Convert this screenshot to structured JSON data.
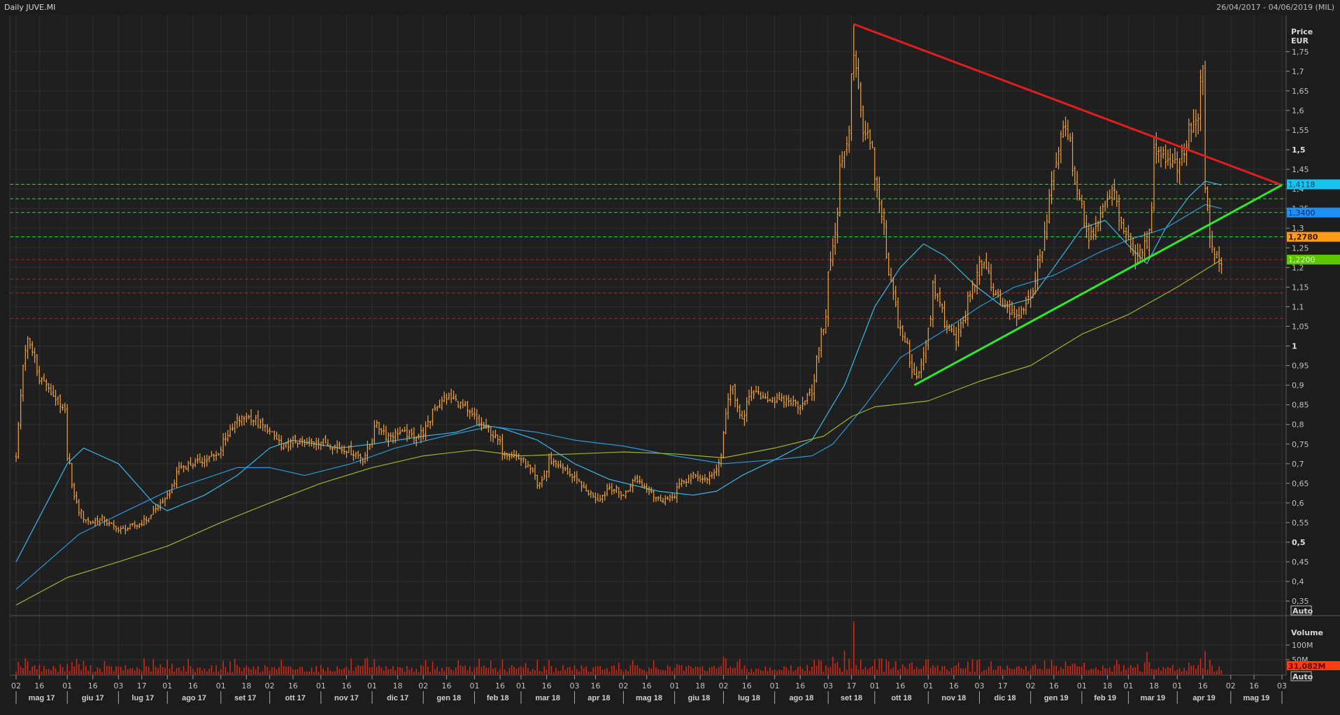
{
  "header": {
    "title": "Daily JUVE.MI",
    "range": "26/04/2017 - 04/06/2019 (MIL)"
  },
  "price_axis": {
    "title": "Price",
    "currency": "EUR",
    "auto": "Auto"
  },
  "volume_axis": {
    "title": "Volume",
    "auto": "Auto",
    "ticks": [
      "100M",
      "50M"
    ],
    "tick_values": [
      100,
      50
    ],
    "last_label": "31,082M",
    "last_color": "#ff3c14"
  },
  "chart_data": {
    "type": "ohlc",
    "title": "Daily JUVE.MI",
    "ylabel": "Price EUR",
    "ylim": [
      0.32,
      1.85
    ],
    "y_ticks": [
      "1,75",
      "1,7",
      "1,65",
      "1,6",
      "1,55",
      "1,5",
      "1,45",
      "1,4",
      "1,35",
      "1,3",
      "1,25",
      "1,2",
      "1,15",
      "1,1",
      "1,05",
      "1",
      "0,95",
      "0,9",
      "0,85",
      "0,8",
      "0,75",
      "0,7",
      "0,65",
      "0,6",
      "0,55",
      "0,5",
      "0,45",
      "0,4",
      "0,35"
    ],
    "y_tick_values": [
      1.75,
      1.7,
      1.65,
      1.6,
      1.55,
      1.5,
      1.45,
      1.4,
      1.35,
      1.3,
      1.25,
      1.2,
      1.15,
      1.1,
      1.05,
      1,
      0.95,
      0.9,
      0.85,
      0.8,
      0.75,
      0.7,
      0.65,
      0.6,
      0.55,
      0.5,
      0.45,
      0.4,
      0.35
    ],
    "y_bold": [
      1.5,
      1,
      0.5
    ],
    "x_range": [
      "2017-05-02",
      "2019-06-03"
    ],
    "close_path": [
      [
        "2017-05-02",
        0.72
      ],
      [
        "2017-05-05",
        0.95
      ],
      [
        "2017-05-09",
        1.01
      ],
      [
        "2017-05-16",
        0.92
      ],
      [
        "2017-05-23",
        0.88
      ],
      [
        "2017-05-31",
        0.83
      ],
      [
        "2017-06-01",
        0.72
      ],
      [
        "2017-06-08",
        0.58
      ],
      [
        "2017-06-15",
        0.55
      ],
      [
        "2017-06-22",
        0.56
      ],
      [
        "2017-07-03",
        0.53
      ],
      [
        "2017-07-10",
        0.54
      ],
      [
        "2017-07-17",
        0.55
      ],
      [
        "2017-07-24",
        0.58
      ],
      [
        "2017-08-01",
        0.62
      ],
      [
        "2017-08-08",
        0.69
      ],
      [
        "2017-08-16",
        0.7
      ],
      [
        "2017-08-23",
        0.71
      ],
      [
        "2017-08-30",
        0.72
      ],
      [
        "2017-09-05",
        0.77
      ],
      [
        "2017-09-12",
        0.81
      ],
      [
        "2017-09-18",
        0.82
      ],
      [
        "2017-09-26",
        0.8
      ],
      [
        "2017-10-02",
        0.78
      ],
      [
        "2017-10-09",
        0.74
      ],
      [
        "2017-10-16",
        0.76
      ],
      [
        "2017-10-23",
        0.75
      ],
      [
        "2017-10-30",
        0.76
      ],
      [
        "2017-11-06",
        0.75
      ],
      [
        "2017-11-13",
        0.74
      ],
      [
        "2017-11-20",
        0.73
      ],
      [
        "2017-11-27",
        0.71
      ],
      [
        "2017-12-04",
        0.8
      ],
      [
        "2017-12-11",
        0.77
      ],
      [
        "2017-12-18",
        0.78
      ],
      [
        "2017-12-27",
        0.77
      ],
      [
        "2018-01-02",
        0.78
      ],
      [
        "2018-01-08",
        0.84
      ],
      [
        "2018-01-15",
        0.87
      ],
      [
        "2018-01-22",
        0.86
      ],
      [
        "2018-01-29",
        0.83
      ],
      [
        "2018-02-05",
        0.8
      ],
      [
        "2018-02-12",
        0.78
      ],
      [
        "2018-02-19",
        0.73
      ],
      [
        "2018-02-26",
        0.72
      ],
      [
        "2018-03-05",
        0.7
      ],
      [
        "2018-03-12",
        0.64
      ],
      [
        "2018-03-19",
        0.71
      ],
      [
        "2018-03-26",
        0.69
      ],
      [
        "2018-04-03",
        0.66
      ],
      [
        "2018-04-10",
        0.63
      ],
      [
        "2018-04-17",
        0.61
      ],
      [
        "2018-04-24",
        0.64
      ],
      [
        "2018-05-02",
        0.62
      ],
      [
        "2018-05-09",
        0.66
      ],
      [
        "2018-05-16",
        0.64
      ],
      [
        "2018-05-23",
        0.61
      ],
      [
        "2018-05-30",
        0.61
      ],
      [
        "2018-06-06",
        0.65
      ],
      [
        "2018-06-13",
        0.67
      ],
      [
        "2018-06-20",
        0.66
      ],
      [
        "2018-06-27",
        0.68
      ],
      [
        "2018-07-02",
        0.78
      ],
      [
        "2018-07-05",
        0.9
      ],
      [
        "2018-07-12",
        0.82
      ],
      [
        "2018-07-19",
        0.88
      ],
      [
        "2018-07-26",
        0.87
      ],
      [
        "2018-08-02",
        0.86
      ],
      [
        "2018-08-09",
        0.86
      ],
      [
        "2018-08-16",
        0.85
      ],
      [
        "2018-08-23",
        0.88
      ],
      [
        "2018-08-30",
        1.05
      ],
      [
        "2018-09-05",
        1.25
      ],
      [
        "2018-09-10",
        1.45
      ],
      [
        "2018-09-14",
        1.55
      ],
      [
        "2018-09-18",
        1.75
      ],
      [
        "2018-09-21",
        1.6
      ],
      [
        "2018-09-28",
        1.5
      ],
      [
        "2018-10-05",
        1.3
      ],
      [
        "2018-10-12",
        1.1
      ],
      [
        "2018-10-19",
        1.0
      ],
      [
        "2018-10-24",
        0.92
      ],
      [
        "2018-10-29",
        0.96
      ],
      [
        "2018-11-05",
        1.15
      ],
      [
        "2018-11-12",
        1.05
      ],
      [
        "2018-11-19",
        1.02
      ],
      [
        "2018-11-26",
        1.12
      ],
      [
        "2018-12-03",
        1.22
      ],
      [
        "2018-12-10",
        1.15
      ],
      [
        "2018-12-17",
        1.1
      ],
      [
        "2018-12-24",
        1.07
      ],
      [
        "2019-01-02",
        1.12
      ],
      [
        "2019-01-09",
        1.25
      ],
      [
        "2019-01-16",
        1.45
      ],
      [
        "2019-01-23",
        1.57
      ],
      [
        "2019-01-30",
        1.4
      ],
      [
        "2019-02-06",
        1.28
      ],
      [
        "2019-02-13",
        1.33
      ],
      [
        "2019-02-20",
        1.4
      ],
      [
        "2019-02-27",
        1.3
      ],
      [
        "2019-03-06",
        1.22
      ],
      [
        "2019-03-13",
        1.26
      ],
      [
        "2019-03-18",
        1.5
      ],
      [
        "2019-03-25",
        1.48
      ],
      [
        "2019-04-01",
        1.46
      ],
      [
        "2019-04-08",
        1.55
      ],
      [
        "2019-04-12",
        1.58
      ],
      [
        "2019-04-16",
        1.7
      ],
      [
        "2019-04-17",
        1.4
      ],
      [
        "2019-04-19",
        1.28
      ],
      [
        "2019-04-26",
        1.2
      ]
    ],
    "peak": {
      "date": "2018-09-18",
      "high": 1.82
    },
    "moving_averages": [
      {
        "name": "MA fast",
        "color": "#39b8e8",
        "points": [
          [
            "2017-05-02",
            0.45
          ],
          [
            "2017-06-01",
            0.7
          ],
          [
            "2017-06-12",
            0.74
          ],
          [
            "2017-07-03",
            0.7
          ],
          [
            "2017-07-24",
            0.6
          ],
          [
            "2017-08-01",
            0.58
          ],
          [
            "2017-08-23",
            0.62
          ],
          [
            "2017-09-12",
            0.67
          ],
          [
            "2017-10-02",
            0.74
          ],
          [
            "2017-10-16",
            0.76
          ],
          [
            "2017-11-13",
            0.74
          ],
          [
            "2017-12-01",
            0.75
          ],
          [
            "2018-01-02",
            0.77
          ],
          [
            "2018-01-22",
            0.78
          ],
          [
            "2018-02-05",
            0.8
          ],
          [
            "2018-02-19",
            0.79
          ],
          [
            "2018-03-12",
            0.76
          ],
          [
            "2018-04-03",
            0.7
          ],
          [
            "2018-04-24",
            0.66
          ],
          [
            "2018-05-23",
            0.63
          ],
          [
            "2018-06-13",
            0.62
          ],
          [
            "2018-06-27",
            0.63
          ],
          [
            "2018-07-12",
            0.67
          ],
          [
            "2018-08-01",
            0.71
          ],
          [
            "2018-08-23",
            0.76
          ],
          [
            "2018-09-12",
            0.9
          ],
          [
            "2018-10-01",
            1.1
          ],
          [
            "2018-10-16",
            1.2
          ],
          [
            "2018-10-30",
            1.26
          ],
          [
            "2018-11-12",
            1.23
          ],
          [
            "2018-11-30",
            1.15
          ],
          [
            "2018-12-17",
            1.1
          ],
          [
            "2019-01-02",
            1.12
          ],
          [
            "2019-01-16",
            1.2
          ],
          [
            "2019-02-01",
            1.3
          ],
          [
            "2019-02-15",
            1.32
          ],
          [
            "2019-03-04",
            1.25
          ],
          [
            "2019-03-13",
            1.21
          ],
          [
            "2019-03-25",
            1.3
          ],
          [
            "2019-04-08",
            1.38
          ],
          [
            "2019-04-17",
            1.42
          ],
          [
            "2019-04-26",
            1.41
          ]
        ]
      },
      {
        "name": "MA medium",
        "color": "#2a9ad8",
        "points": [
          [
            "2017-05-02",
            0.38
          ],
          [
            "2017-06-08",
            0.52
          ],
          [
            "2017-07-03",
            0.57
          ],
          [
            "2017-08-01",
            0.63
          ],
          [
            "2017-09-12",
            0.69
          ],
          [
            "2017-10-02",
            0.69
          ],
          [
            "2017-10-23",
            0.67
          ],
          [
            "2017-11-20",
            0.7
          ],
          [
            "2017-12-15",
            0.74
          ],
          [
            "2018-01-15",
            0.77
          ],
          [
            "2018-02-12",
            0.795
          ],
          [
            "2018-03-12",
            0.78
          ],
          [
            "2018-04-03",
            0.76
          ],
          [
            "2018-05-02",
            0.745
          ],
          [
            "2018-06-01",
            0.72
          ],
          [
            "2018-07-02",
            0.7
          ],
          [
            "2018-08-01",
            0.71
          ],
          [
            "2018-08-23",
            0.72
          ],
          [
            "2018-09-05",
            0.75
          ],
          [
            "2018-09-25",
            0.85
          ],
          [
            "2018-10-16",
            0.97
          ],
          [
            "2018-11-12",
            1.04
          ],
          [
            "2018-12-03",
            1.1
          ],
          [
            "2018-12-24",
            1.15
          ],
          [
            "2019-01-16",
            1.18
          ],
          [
            "2019-02-13",
            1.24
          ],
          [
            "2019-03-01",
            1.27
          ],
          [
            "2019-03-25",
            1.3
          ],
          [
            "2019-04-17",
            1.36
          ],
          [
            "2019-04-26",
            1.35
          ]
        ]
      },
      {
        "name": "MA slow",
        "color": "#9ab828",
        "points": [
          [
            "2017-05-02",
            0.34
          ],
          [
            "2017-06-01",
            0.41
          ],
          [
            "2017-07-03",
            0.45
          ],
          [
            "2017-08-01",
            0.49
          ],
          [
            "2017-09-01",
            0.55
          ],
          [
            "2017-10-02",
            0.6
          ],
          [
            "2017-11-01",
            0.65
          ],
          [
            "2017-12-01",
            0.69
          ],
          [
            "2018-01-02",
            0.72
          ],
          [
            "2018-02-01",
            0.735
          ],
          [
            "2018-03-01",
            0.72
          ],
          [
            "2018-04-03",
            0.725
          ],
          [
            "2018-05-02",
            0.73
          ],
          [
            "2018-06-01",
            0.725
          ],
          [
            "2018-07-02",
            0.715
          ],
          [
            "2018-08-01",
            0.74
          ],
          [
            "2018-08-30",
            0.77
          ],
          [
            "2018-09-17",
            0.82
          ],
          [
            "2018-10-01",
            0.845
          ],
          [
            "2018-11-01",
            0.86
          ],
          [
            "2018-12-03",
            0.91
          ],
          [
            "2019-01-02",
            0.95
          ],
          [
            "2019-02-01",
            1.03
          ],
          [
            "2019-03-01",
            1.08
          ],
          [
            "2019-04-01",
            1.15
          ],
          [
            "2019-04-26",
            1.22
          ]
        ]
      }
    ],
    "trendlines": [
      {
        "name": "resistance",
        "color": "#e01e1e",
        "from": [
          "2018-09-18",
          1.82
        ],
        "to": [
          "2019-06-03",
          1.41
        ]
      },
      {
        "name": "support",
        "color": "#2ee82e",
        "from": [
          "2018-10-24",
          0.9
        ],
        "to": [
          "2019-06-03",
          1.41
        ]
      }
    ],
    "horizontal_levels": {
      "green": [
        1.4118,
        1.375,
        1.34,
        1.278
      ],
      "red": [
        1.22,
        1.17,
        1.135,
        1.07
      ]
    },
    "price_labels": [
      {
        "text": "1,4118",
        "value": 1.4118,
        "bg": "#19c3ef",
        "fg": "#0a3d6a"
      },
      {
        "text": "1,3400",
        "value": 1.34,
        "bg": "#1e8fff",
        "fg": "#0a2a5a"
      },
      {
        "text": "1,2780",
        "value": 1.278,
        "bg": "#ff9a1a",
        "fg": "#3a1a00"
      },
      {
        "text": "1,2200",
        "value": 1.22,
        "bg": "#5cc800",
        "fg": "#dff5c0"
      }
    ],
    "volume": {
      "unit": "M",
      "typical": 20,
      "spikes": [
        [
          "2017-05-09",
          45
        ],
        [
          "2017-06-01",
          35
        ],
        [
          "2018-07-02",
          60
        ],
        [
          "2018-09-05",
          60
        ],
        [
          "2018-09-18",
          180
        ],
        [
          "2018-09-12",
          80
        ],
        [
          "2018-10-12",
          45
        ],
        [
          "2019-01-23",
          45
        ],
        [
          "2019-03-13",
          75
        ],
        [
          "2019-04-17",
          80
        ],
        [
          "2019-04-19",
          50
        ]
      ]
    },
    "x_ticks": [
      [
        "2017-05-02",
        "02"
      ],
      [
        "2017-05-16",
        "16"
      ],
      [
        "2017-06-01",
        "01"
      ],
      [
        "2017-06-16",
        "16"
      ],
      [
        "2017-07-03",
        "03"
      ],
      [
        "2017-07-17",
        "17"
      ],
      [
        "2017-08-01",
        "01"
      ],
      [
        "2017-08-16",
        "16"
      ],
      [
        "2017-09-01",
        "01"
      ],
      [
        "2017-09-18",
        "18"
      ],
      [
        "2017-10-02",
        "02"
      ],
      [
        "2017-10-16",
        "16"
      ],
      [
        "2017-11-01",
        "01"
      ],
      [
        "2017-11-16",
        "16"
      ],
      [
        "2017-12-01",
        "01"
      ],
      [
        "2017-12-18",
        "18"
      ],
      [
        "2018-01-02",
        "02"
      ],
      [
        "2018-01-16",
        "16"
      ],
      [
        "2018-02-01",
        "01"
      ],
      [
        "2018-02-16",
        "16"
      ],
      [
        "2018-03-01",
        "01"
      ],
      [
        "2018-03-16",
        "16"
      ],
      [
        "2018-04-03",
        "03"
      ],
      [
        "2018-04-16",
        "16"
      ],
      [
        "2018-05-02",
        "02"
      ],
      [
        "2018-05-16",
        "16"
      ],
      [
        "2018-06-01",
        "01"
      ],
      [
        "2018-06-18",
        "18"
      ],
      [
        "2018-07-02",
        "02"
      ],
      [
        "2018-07-16",
        "16"
      ],
      [
        "2018-08-01",
        "01"
      ],
      [
        "2018-08-16",
        "16"
      ],
      [
        "2018-09-03",
        "03"
      ],
      [
        "2018-09-17",
        "17"
      ],
      [
        "2018-10-01",
        "01"
      ],
      [
        "2018-10-16",
        "16"
      ],
      [
        "2018-11-01",
        "01"
      ],
      [
        "2018-11-16",
        "16"
      ],
      [
        "2018-12-03",
        "03"
      ],
      [
        "2018-12-17",
        "17"
      ],
      [
        "2019-01-02",
        "02"
      ],
      [
        "2019-01-16",
        "16"
      ],
      [
        "2019-02-01",
        "01"
      ],
      [
        "2019-02-18",
        "18"
      ],
      [
        "2019-03-01",
        "01"
      ],
      [
        "2019-03-18",
        "18"
      ],
      [
        "2019-04-01",
        "01"
      ],
      [
        "2019-04-16",
        "16"
      ],
      [
        "2019-05-02",
        "02"
      ],
      [
        "2019-05-16",
        "16"
      ],
      [
        "2019-06-03",
        "03"
      ]
    ],
    "months": [
      "mag 17",
      "giu 17",
      "lug 17",
      "ago 17",
      "set 17",
      "ott 17",
      "nov 17",
      "dic 17",
      "gen 18",
      "feb 18",
      "mar 18",
      "apr 18",
      "mag 18",
      "giu 18",
      "lug 18",
      "ago 18",
      "set 18",
      "ott 18",
      "nov 18",
      "dic 18",
      "gen 19",
      "feb 19",
      "mar 19",
      "apr 19",
      "mag 19"
    ],
    "colors": {
      "bars": "#f0a040",
      "volume": "#d02818",
      "grid": "#2f2f2f",
      "background": "#1f1f1f"
    }
  }
}
